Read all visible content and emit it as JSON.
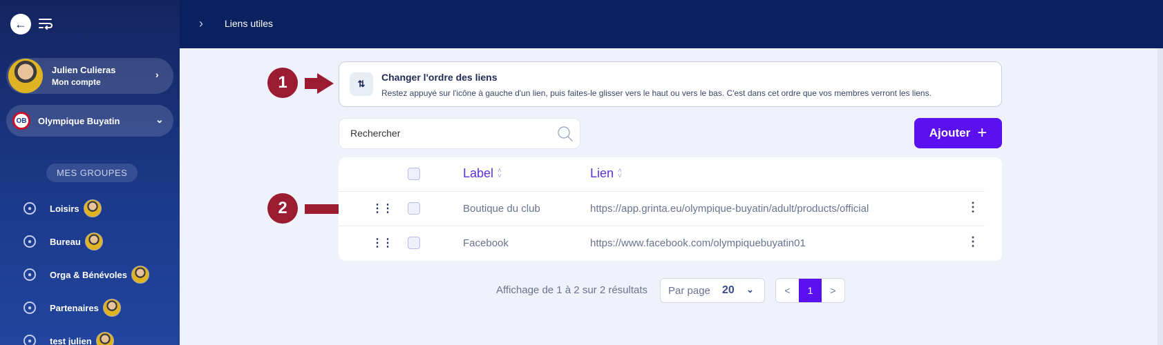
{
  "sidebar": {
    "account": {
      "name": "Julien Culieras",
      "sub": "Mon compte"
    },
    "club": {
      "name": "Olympique Buyatin"
    },
    "groups_heading": "MES GROUPES",
    "groups": [
      {
        "label": "Loisirs"
      },
      {
        "label": "Bureau"
      },
      {
        "label": "Orga & Bénévoles"
      },
      {
        "label": "Partenaires"
      },
      {
        "label": "test julien"
      }
    ]
  },
  "header": {
    "title": "Liens utiles"
  },
  "info": {
    "title": "Changer l'ordre des liens",
    "text": "Restez appuyé sur l'icône à gauche d'un lien, puis faites-le glisser vers le haut ou vers le bas. C'est dans cet ordre que vos membres verront les liens."
  },
  "callouts": [
    "1",
    "2"
  ],
  "search": {
    "placeholder": "Rechercher"
  },
  "add_button": {
    "label": "Ajouter"
  },
  "table": {
    "columns": [
      "Label",
      "Lien"
    ],
    "rows": [
      {
        "label": "Boutique du club",
        "link": "https://app.grinta.eu/olympique-buyatin/adult/products/official"
      },
      {
        "label": "Facebook",
        "link": "https://www.facebook.com/olympiquebuyatin01"
      }
    ]
  },
  "pagination": {
    "results_text": "Affichage de 1 à 2 sur 2 résultats",
    "per_page_label": "Par page",
    "per_page_value": "20",
    "prev": "<",
    "current": "1",
    "next": ">"
  },
  "colors": {
    "sidebar": "#1c3a8c",
    "topbar": "#0a2160",
    "accent": "#5b10f0",
    "callout": "#9b1b30"
  }
}
